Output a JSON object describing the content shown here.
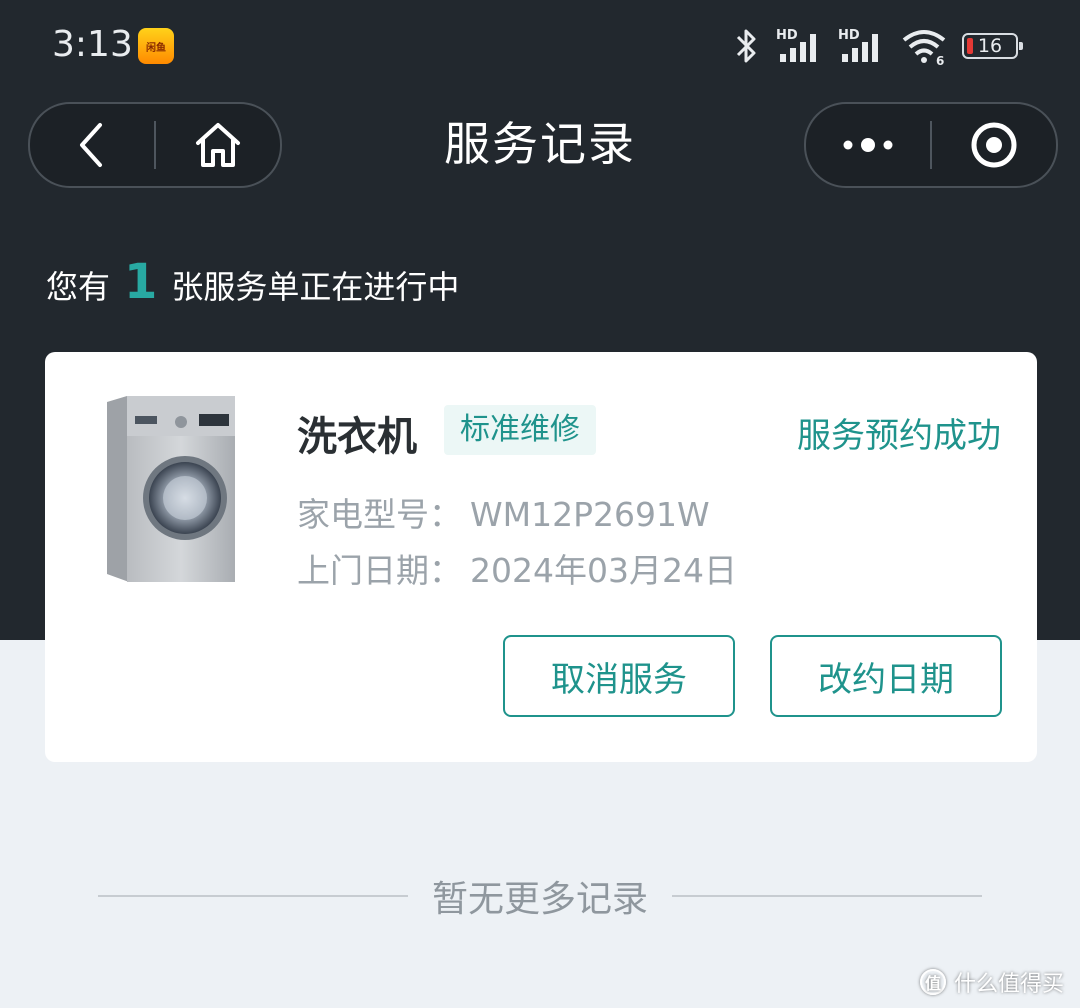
{
  "status_bar": {
    "time": "3:13",
    "app_badge_text": "闲鱼",
    "battery_level": "16",
    "signal_label_1": "HD",
    "signal_label_2": "HD",
    "wifi_label": "6"
  },
  "nav": {
    "title": "服务记录",
    "icons": [
      "back-icon",
      "home-icon",
      "more-icon",
      "record-icon"
    ]
  },
  "summary": {
    "prefix": "您有",
    "count": "1",
    "suffix": "张服务单正在进行中"
  },
  "service_card": {
    "product_name": "洗衣机",
    "service_type": "标准维修",
    "status": "服务预约成功",
    "model_label": "家电型号：",
    "model_value": "WM12P2691W",
    "date_label": "上门日期：",
    "date_value": "2024年03月24日",
    "cancel_label": "取消服务",
    "reschedule_label": "改约日期"
  },
  "footer": {
    "no_more_text": "暂无更多记录"
  },
  "watermark": {
    "logo_text": "值",
    "text": "什么值得买"
  },
  "colors": {
    "accent": "#1f938c",
    "header_bg": "#22282e",
    "page_bg": "#edf1f5"
  }
}
